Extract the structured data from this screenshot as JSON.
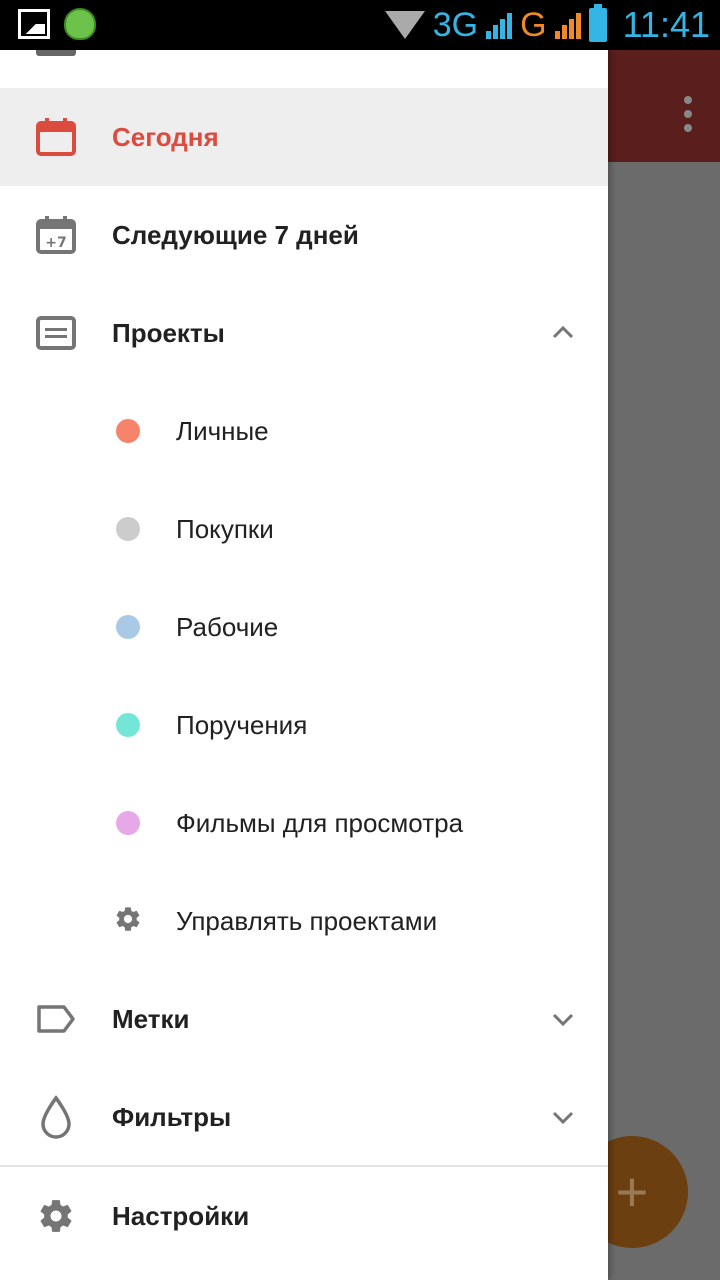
{
  "status_bar": {
    "net_1": "3G",
    "net_2": "G",
    "sim_1": "1",
    "sim_2": "2",
    "time": "11:41"
  },
  "drawer": {
    "items": [
      {
        "label": "Сегодня",
        "icon": "calendar-icon",
        "active": true
      },
      {
        "label": "Следующие 7 дней",
        "icon": "calendar-plus-7-icon"
      },
      {
        "label": "Проекты",
        "icon": "projects-icon",
        "expanded": true
      }
    ],
    "projects": [
      {
        "label": "Личные",
        "color": "#f8836b"
      },
      {
        "label": "Покупки",
        "color": "#cccccc"
      },
      {
        "label": "Рабочие",
        "color": "#a9c9e6"
      },
      {
        "label": "Поручения",
        "color": "#73e6d8"
      },
      {
        "label": "Фильмы для просмотра",
        "color": "#e6a8e6"
      }
    ],
    "manage_projects": "Управлять проектами",
    "labels": "Метки",
    "filters": "Фильтры",
    "settings": "Настройки"
  },
  "fab": {
    "label": "+"
  },
  "colors": {
    "accent": "#db4c3f",
    "appbar": "#5a1e1c",
    "icon_gray": "#757575"
  }
}
